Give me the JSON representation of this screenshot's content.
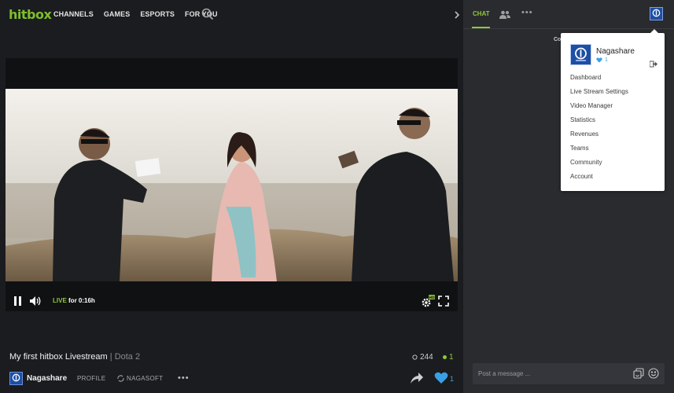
{
  "brand": {
    "logo": "hitbox",
    "accent": "#7fbf2a"
  },
  "nav": {
    "items": [
      "CHANNELS",
      "GAMES",
      "ESPORTS",
      "FOR YOU"
    ],
    "search_icon": "search-icon"
  },
  "player": {
    "live_label": "LIVE",
    "duration": "for 0:16h",
    "controls": [
      "pause-icon",
      "volume-icon",
      "quality-gear-icon",
      "fullscreen-icon"
    ]
  },
  "stream": {
    "title": "My first hitbox Livestream",
    "separator": "|",
    "game": "Dota 2",
    "viewers": "244",
    "followers_online": "1"
  },
  "channel_bar": {
    "name": "Nagashare",
    "profile_label": "PROFILE",
    "team_label": "NAGASOFT",
    "more_label": "•••",
    "follow_count": "1"
  },
  "chat": {
    "tab_label": "CHAT",
    "more_label": "•••",
    "truncated_text": "Co",
    "input_placeholder": "Post a message ..."
  },
  "user_menu": {
    "username": "Nagashare",
    "hearts": "1",
    "items": [
      "Dashboard",
      "Live Stream Settings",
      "Video Manager",
      "Statistics",
      "Revenues",
      "Teams",
      "Community",
      "Account"
    ]
  },
  "colors": {
    "live_green": "#90c93a",
    "heart_blue": "#3aa0e6",
    "avatar_blue": "#1d4fa3"
  }
}
